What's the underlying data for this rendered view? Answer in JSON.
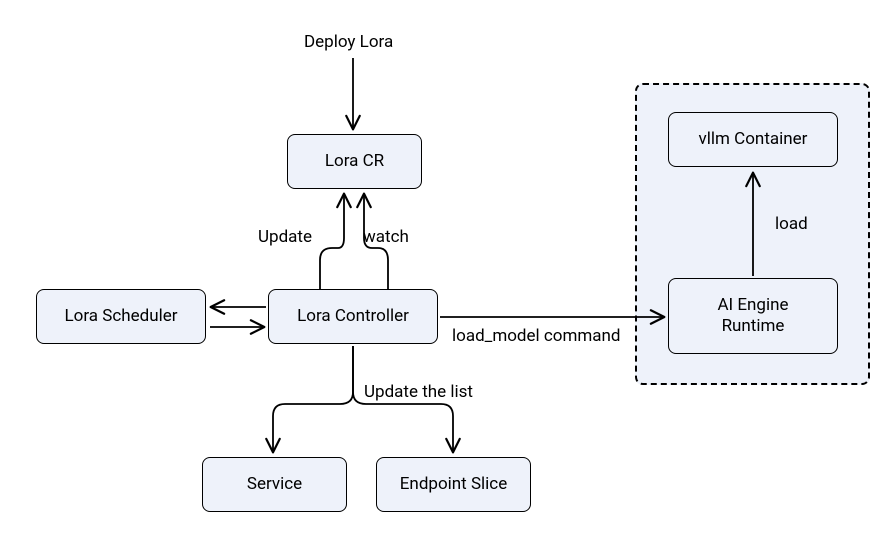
{
  "labels": {
    "deploy": "Deploy Lora",
    "update": "Update",
    "watch": "watch",
    "load_cmd": "load_model command",
    "load": "load",
    "update_list": "Update the list"
  },
  "nodes": {
    "lora_cr": "Lora CR",
    "lora_scheduler": "Lora Scheduler",
    "lora_controller": "Lora Controller",
    "vllm": "vllm Container",
    "ai_engine": "AI Engine\nRuntime",
    "service": "Service",
    "endpoint_slice": "Endpoint Slice"
  }
}
